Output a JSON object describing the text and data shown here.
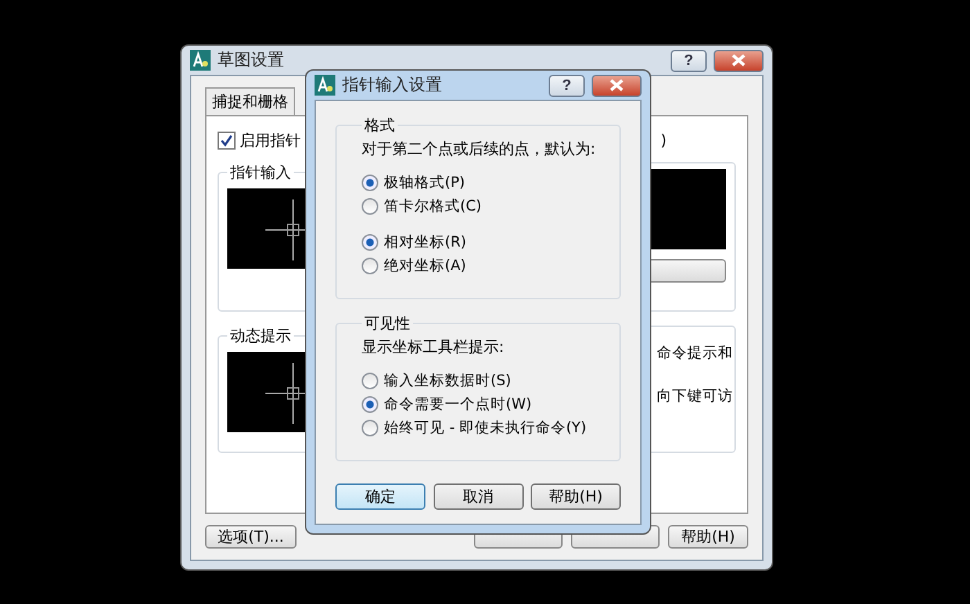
{
  "back_dialog": {
    "title": "草图设置",
    "help_glyph": "?",
    "tabs": [
      {
        "label": "捕捉和栅格",
        "selected": false
      }
    ],
    "enable_checkbox": {
      "label": "启用指针",
      "checked": true
    },
    "right_fragment": ")",
    "groups": [
      {
        "title": "指针输入"
      },
      {
        "title": "动态提示"
      }
    ],
    "notes": [
      "命令提示和",
      "向下键可访"
    ],
    "buttons": [
      {
        "label": "选项(T)..."
      },
      {
        "label": "帮助(H)"
      }
    ]
  },
  "front_dialog": {
    "title": "指针输入设置",
    "help_glyph": "?",
    "groups": [
      {
        "title": "格式",
        "caption": "对于第二个点或后续的点，默认为:",
        "radio_sets": [
          [
            {
              "label": "极轴格式(P)",
              "selected": true
            },
            {
              "label": "笛卡尔格式(C)",
              "selected": false
            }
          ],
          [
            {
              "label": "相对坐标(R)",
              "selected": true
            },
            {
              "label": "绝对坐标(A)",
              "selected": false
            }
          ]
        ]
      },
      {
        "title": "可见性",
        "caption": "显示坐标工具栏提示:",
        "radio_sets": [
          [
            {
              "label": "输入坐标数据时(S)",
              "selected": false
            },
            {
              "label": "命令需要一个点时(W)",
              "selected": true
            },
            {
              "label": "始终可见 - 即使未执行命令(Y)",
              "selected": false
            }
          ]
        ]
      }
    ],
    "buttons": [
      {
        "label": "确定",
        "default": true
      },
      {
        "label": "取消",
        "default": false
      },
      {
        "label": "帮助(H)",
        "default": false
      }
    ]
  }
}
